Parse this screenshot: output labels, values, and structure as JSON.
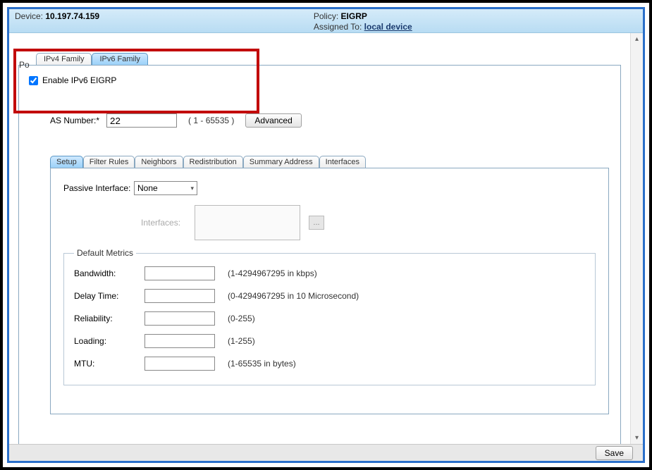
{
  "header": {
    "device_label": "Device:",
    "device_value": "10.197.74.159",
    "policy_label": "Policy:",
    "policy_value": "EIGRP",
    "assigned_label": "Assigned To:",
    "assigned_value": "local device",
    "policy_assigned_truncated": "Po"
  },
  "family_tabs": {
    "ipv4": "IPv4 Family",
    "ipv6": "IPv6 Family"
  },
  "enable_checkbox_label": "Enable IPv6 EIGRP",
  "asn": {
    "label": "AS Number:*",
    "value": "22",
    "range": "( 1 - 65535 )",
    "advanced_btn": "Advanced"
  },
  "inner_tabs": {
    "setup": "Setup",
    "filter_rules": "Filter Rules",
    "neighbors": "Neighbors",
    "redistribution": "Redistribution",
    "summary_address": "Summary Address",
    "interfaces": "Interfaces"
  },
  "passive_interface": {
    "label": "Passive Interface:",
    "value": "None",
    "sublabel": "Interfaces:",
    "browse": "..."
  },
  "default_metrics": {
    "legend": "Default Metrics",
    "bandwidth": {
      "label": "Bandwidth:",
      "value": "",
      "hint": "(1-4294967295 in kbps)"
    },
    "delay": {
      "label": "Delay Time:",
      "value": "",
      "hint": "(0-4294967295 in 10 Microsecond)"
    },
    "reliability": {
      "label": "Reliability:",
      "value": "",
      "hint": "(0-255)"
    },
    "loading": {
      "label": "Loading:",
      "value": "",
      "hint": "(1-255)"
    },
    "mtu": {
      "label": "MTU:",
      "value": "",
      "hint": "(1-65535 in bytes)"
    }
  },
  "footer": {
    "save": "Save"
  },
  "scrollbar": {
    "up": "▴",
    "down": "▾"
  }
}
